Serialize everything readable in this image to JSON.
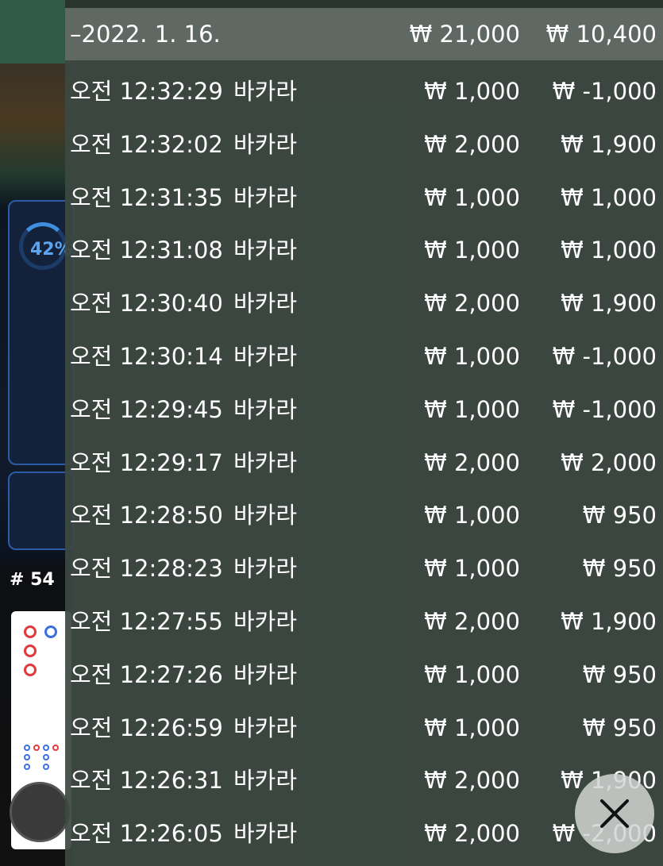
{
  "background": {
    "percent": "42%",
    "round": "# 54"
  },
  "history": {
    "date_header": {
      "date": "–2022. 1. 16.",
      "total_bet": "₩ 21,000",
      "total_win": "₩ 10,400"
    },
    "rows": [
      {
        "time": "오전 12:32:29",
        "game": "바카라",
        "bet": "₩ 1,000",
        "win": "₩ -1,000"
      },
      {
        "time": "오전 12:32:02",
        "game": "바카라",
        "bet": "₩ 2,000",
        "win": "₩ 1,900"
      },
      {
        "time": "오전 12:31:35",
        "game": "바카라",
        "bet": "₩ 1,000",
        "win": "₩ 1,000"
      },
      {
        "time": "오전 12:31:08",
        "game": "바카라",
        "bet": "₩ 1,000",
        "win": "₩ 1,000"
      },
      {
        "time": "오전 12:30:40",
        "game": "바카라",
        "bet": "₩ 2,000",
        "win": "₩ 1,900"
      },
      {
        "time": "오전 12:30:14",
        "game": "바카라",
        "bet": "₩ 1,000",
        "win": "₩ -1,000"
      },
      {
        "time": "오전 12:29:45",
        "game": "바카라",
        "bet": "₩ 1,000",
        "win": "₩ -1,000"
      },
      {
        "time": "오전 12:29:17",
        "game": "바카라",
        "bet": "₩ 2,000",
        "win": "₩ 2,000"
      },
      {
        "time": "오전 12:28:50",
        "game": "바카라",
        "bet": "₩ 1,000",
        "win": "₩ 950"
      },
      {
        "time": "오전 12:28:23",
        "game": "바카라",
        "bet": "₩ 1,000",
        "win": "₩ 950"
      },
      {
        "time": "오전 12:27:55",
        "game": "바카라",
        "bet": "₩ 2,000",
        "win": "₩ 1,900"
      },
      {
        "time": "오전 12:27:26",
        "game": "바카라",
        "bet": "₩ 1,000",
        "win": "₩ 950"
      },
      {
        "time": "오전 12:26:59",
        "game": "바카라",
        "bet": "₩ 1,000",
        "win": "₩ 950"
      },
      {
        "time": "오전 12:26:31",
        "game": "바카라",
        "bet": "₩ 2,000",
        "win": "₩ 1,900"
      },
      {
        "time": "오전 12:26:05",
        "game": "바카라",
        "bet": "₩ 2,000",
        "win": "₩ -2,000"
      }
    ]
  },
  "close_button": {
    "icon": "close-icon"
  }
}
